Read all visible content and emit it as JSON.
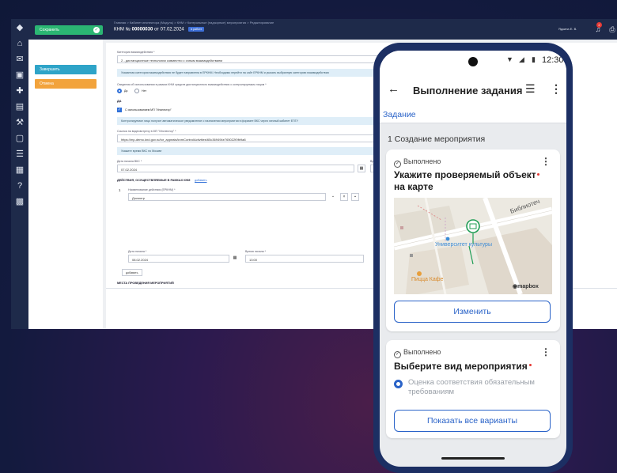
{
  "desktop": {
    "breadcrumbs": "Главная  >  Кабинет инспектора (Модуль)  >  КНМ  >  Контрольные (надзорные) мероприятия  >  Редактирование",
    "save_button": "Сохранить",
    "title_prefix": "КНМ №",
    "title_number": "00000030",
    "title_suffix": "от 07.02.2024",
    "status_badge": "в работе",
    "user_name": "Ядкина Е. В.",
    "notifications_count": "2",
    "actions": {
      "complete": "Завершить",
      "cancel": "Отмена"
    },
    "form": {
      "interaction_category_label": "Категория взаимодействия *",
      "interaction_category_value": "2 - дистанционные технологии совместно с очным взаимодействием",
      "info_category": "Указанная категория взаимодействия не будет направлена в ЕРКНМ. Необходимо перейти на сайт ЕРКНМ и указать выбранную категорию взаимодействия",
      "remote_usage_label": "Сведения об использовании в рамках КНМ средств дистанционного взаимодействия с контролируемым лицом *",
      "radio_yes": "Да",
      "radio_no": "Нет",
      "yes_header": "ДА",
      "checkbox_label": "С использованием МП \"Инспектор\"",
      "info_notification": "Контролируемое лицо получит автоматическое уведомление о назначении мероприятия в формате ВКС через личный кабинет ЕПГУ",
      "video_link_label": "Ссылка на видеовстречу в МП \"Инспектор\" *",
      "video_link_value": "https://mp-demo.knd.gov.ru/tor_appeals/knmControlActivities/65c369494e765022f0fb9a8",
      "info_time": "Укажите время ВКС по Москве",
      "vks_date_label": "Дата начала ВКС *",
      "vks_date_value": "07.02.2024",
      "vks_time_label": "Время",
      "vks_time_value": "10",
      "actions_header": "ДЕЙСТВИЯ, ОСУЩЕСТВЛЯЕМЫЕ В РАМКАХ КНМ",
      "actions_add_link": "добавить",
      "action_number": "1",
      "action_name_label": "Наименование действия (ЕРКНМ) *",
      "action_name_value": "Досмотр",
      "action_date_label": "Дата начала *",
      "action_date_value": "08.02.2024",
      "action_time_label": "Время начала *",
      "action_time_value": "13:00",
      "add_button": "добавить",
      "places_header": "МЕСТА ПРОВЕДЕНИЯ МЕРОПРИЯТИЙ"
    }
  },
  "phone": {
    "status_time": "12:30",
    "appbar_title": "Выполнение задания",
    "tab_label": "Задание",
    "section_label": "1 Создание мероприятия",
    "card1": {
      "status": "Выполнено",
      "title": "Укажите проверяемый объект на карте",
      "button": "Изменить",
      "map_street": "Библиотечная",
      "map_poi": "Университет культуры",
      "map_cafe": "Пицца Кафе",
      "map_brand": "mapbox"
    },
    "card2": {
      "status": "Выполнено",
      "title": "Выберите вид мероприятия",
      "option": "Оценка соответствия обязательным требованиям",
      "button": "Показать все варианты"
    }
  }
}
